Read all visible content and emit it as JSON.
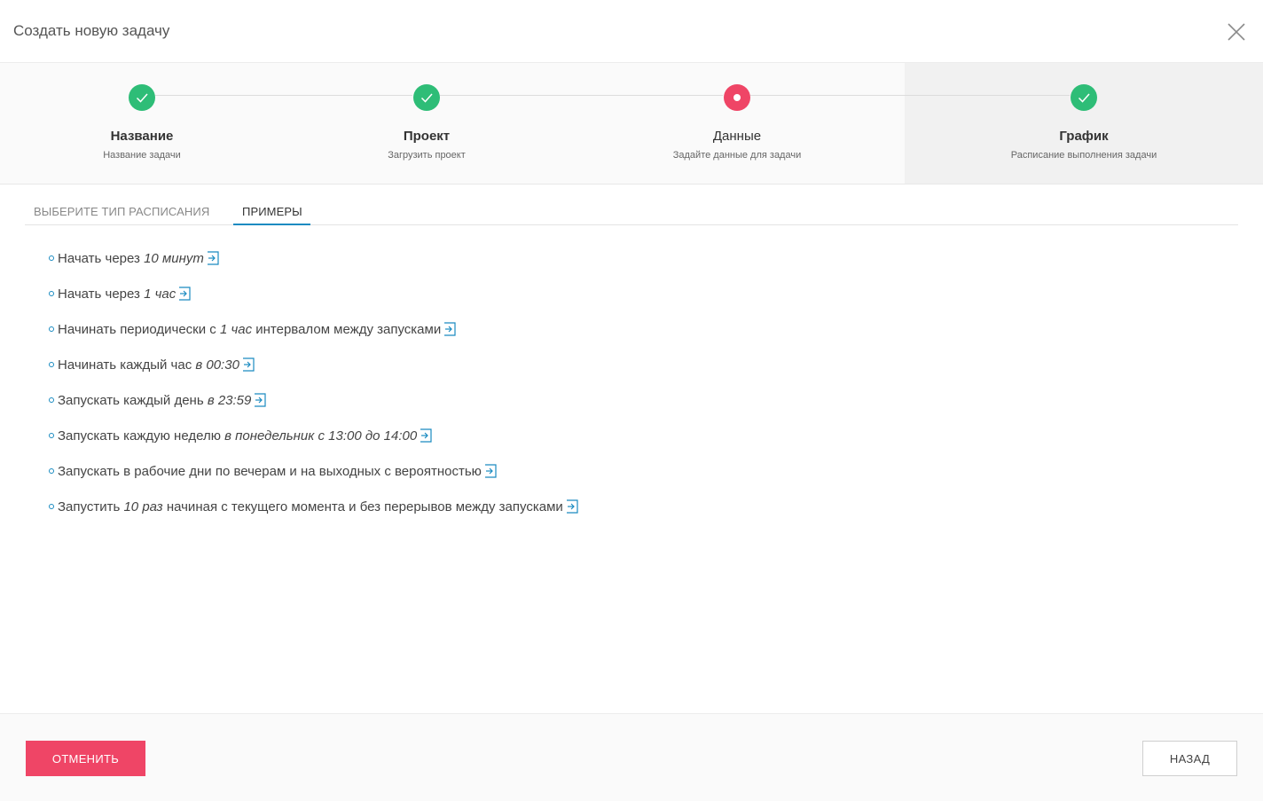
{
  "header": {
    "title": "Создать новую задачу",
    "close_icon": "close-icon"
  },
  "steps": [
    {
      "title": "Название",
      "subtitle": "Название задачи",
      "status": "done"
    },
    {
      "title": "Проект",
      "subtitle": "Загрузить проект",
      "status": "done"
    },
    {
      "title": "Данные",
      "subtitle": "Задайте данные для задачи",
      "status": "current"
    },
    {
      "title": "График",
      "subtitle": "Расписание выполнения задачи",
      "status": "done",
      "active": true
    }
  ],
  "tabs": [
    {
      "label": "ВЫБЕРИТЕ ТИП РАСПИСАНИЯ",
      "selected": false
    },
    {
      "label": "ПРИМЕРЫ",
      "selected": true
    }
  ],
  "examples": [
    {
      "parts": [
        {
          "text": "Начать через ",
          "italic": false
        },
        {
          "text": "10 минут",
          "italic": true
        }
      ]
    },
    {
      "parts": [
        {
          "text": "Начать через ",
          "italic": false
        },
        {
          "text": "1 час",
          "italic": true
        }
      ]
    },
    {
      "parts": [
        {
          "text": "Начинать периодически с ",
          "italic": false
        },
        {
          "text": "1 час",
          "italic": true
        },
        {
          "text": " интервалом между запусками",
          "italic": false
        }
      ]
    },
    {
      "parts": [
        {
          "text": "Начинать каждый час ",
          "italic": false
        },
        {
          "text": "в 00:30",
          "italic": true
        }
      ]
    },
    {
      "parts": [
        {
          "text": "Запускать каждый день ",
          "italic": false
        },
        {
          "text": "в 23:59",
          "italic": true
        }
      ]
    },
    {
      "parts": [
        {
          "text": "Запускать каждую неделю ",
          "italic": false
        },
        {
          "text": "в понедельник с 13:00 до 14:00",
          "italic": true
        }
      ]
    },
    {
      "parts": [
        {
          "text": "Запускать в рабочие дни по вечерам и на выходных с вероятностью",
          "italic": false
        }
      ]
    },
    {
      "parts": [
        {
          "text": "Запустить ",
          "italic": false
        },
        {
          "text": "10 раз",
          "italic": true
        },
        {
          "text": " начиная с текущего момента и без перерывов между запусками",
          "italic": false
        }
      ]
    }
  ],
  "footer": {
    "cancel_label": "ОТМЕНИТЬ",
    "back_label": "НАЗАД"
  },
  "colors": {
    "success": "#2ebd77",
    "danger": "#ef4566",
    "accent": "#1a8bc1"
  }
}
